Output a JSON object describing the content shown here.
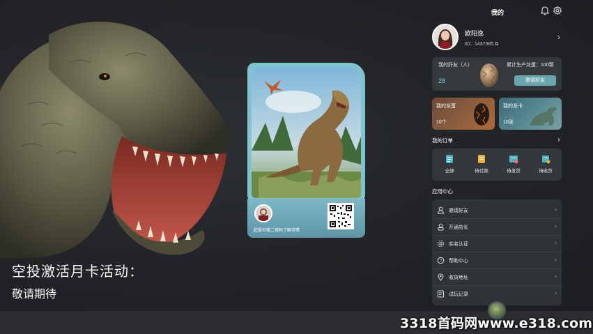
{
  "promo": {
    "title": "空投激活月卡活动：",
    "subtitle": "敬请期待"
  },
  "card": {
    "scan_text": "赶紧扫描二维码了解详情"
  },
  "header": {
    "tab_label": "我的",
    "bell_icon": "bell-icon",
    "settings_icon": "gear-icon"
  },
  "profile": {
    "name": "欧阳逸",
    "id_text": "ID：1437385"
  },
  "friends": {
    "label": "我的好友（人）",
    "count": "28",
    "egg_total": "累计生产龙蛋：100颗",
    "invite_label": "邀请好友"
  },
  "tiles": {
    "dragon_label": "我的龙蛋",
    "dragon_count": "10个",
    "card_label": "我的龙卡",
    "card_count": "10张"
  },
  "orders": {
    "title": "我的订单",
    "items": [
      {
        "label": "全部",
        "icon": "clipboard-list-icon"
      },
      {
        "label": "待付款",
        "icon": "wallet-icon"
      },
      {
        "label": "待发货",
        "icon": "package-icon"
      },
      {
        "label": "待收货",
        "icon": "delivery-icon"
      }
    ]
  },
  "app_center": {
    "title": "应用中心",
    "items": [
      {
        "label": "邀请好友",
        "icon": "user-icon"
      },
      {
        "label": "开通店长",
        "icon": "manager-icon"
      },
      {
        "label": "实名认证",
        "icon": "settings-icon"
      },
      {
        "label": "帮助中心",
        "icon": "help-icon"
      },
      {
        "label": "收货地址",
        "icon": "location-icon"
      },
      {
        "label": "试玩记录",
        "icon": "record-icon"
      }
    ]
  },
  "watermark": "3318首码网www.e318.com",
  "colors": {
    "accent": "#6ba6ae",
    "card_frame": "#7fc3cf",
    "panel_bg": "#34373c"
  }
}
